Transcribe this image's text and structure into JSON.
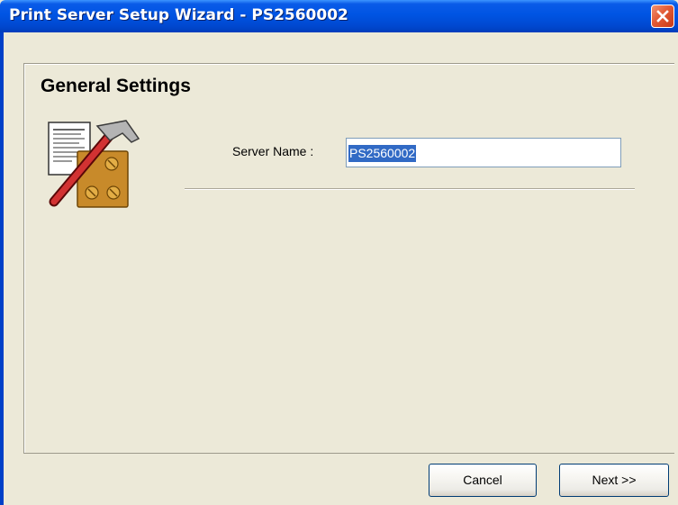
{
  "window": {
    "title": "Print Server Setup Wizard - PS2560002",
    "close_icon": "close-icon"
  },
  "page": {
    "heading": "General Settings",
    "icon": "wizard-settings-icon"
  },
  "form": {
    "server_name_label": "Server Name :",
    "server_name_value": "PS2560002"
  },
  "buttons": {
    "cancel_label": "Cancel",
    "next_label": "Next >>"
  },
  "colors": {
    "titlebar": "#0054e3",
    "window_bg": "#ece9d8",
    "selection": "#316ac5",
    "close_button": "#e25a35"
  }
}
